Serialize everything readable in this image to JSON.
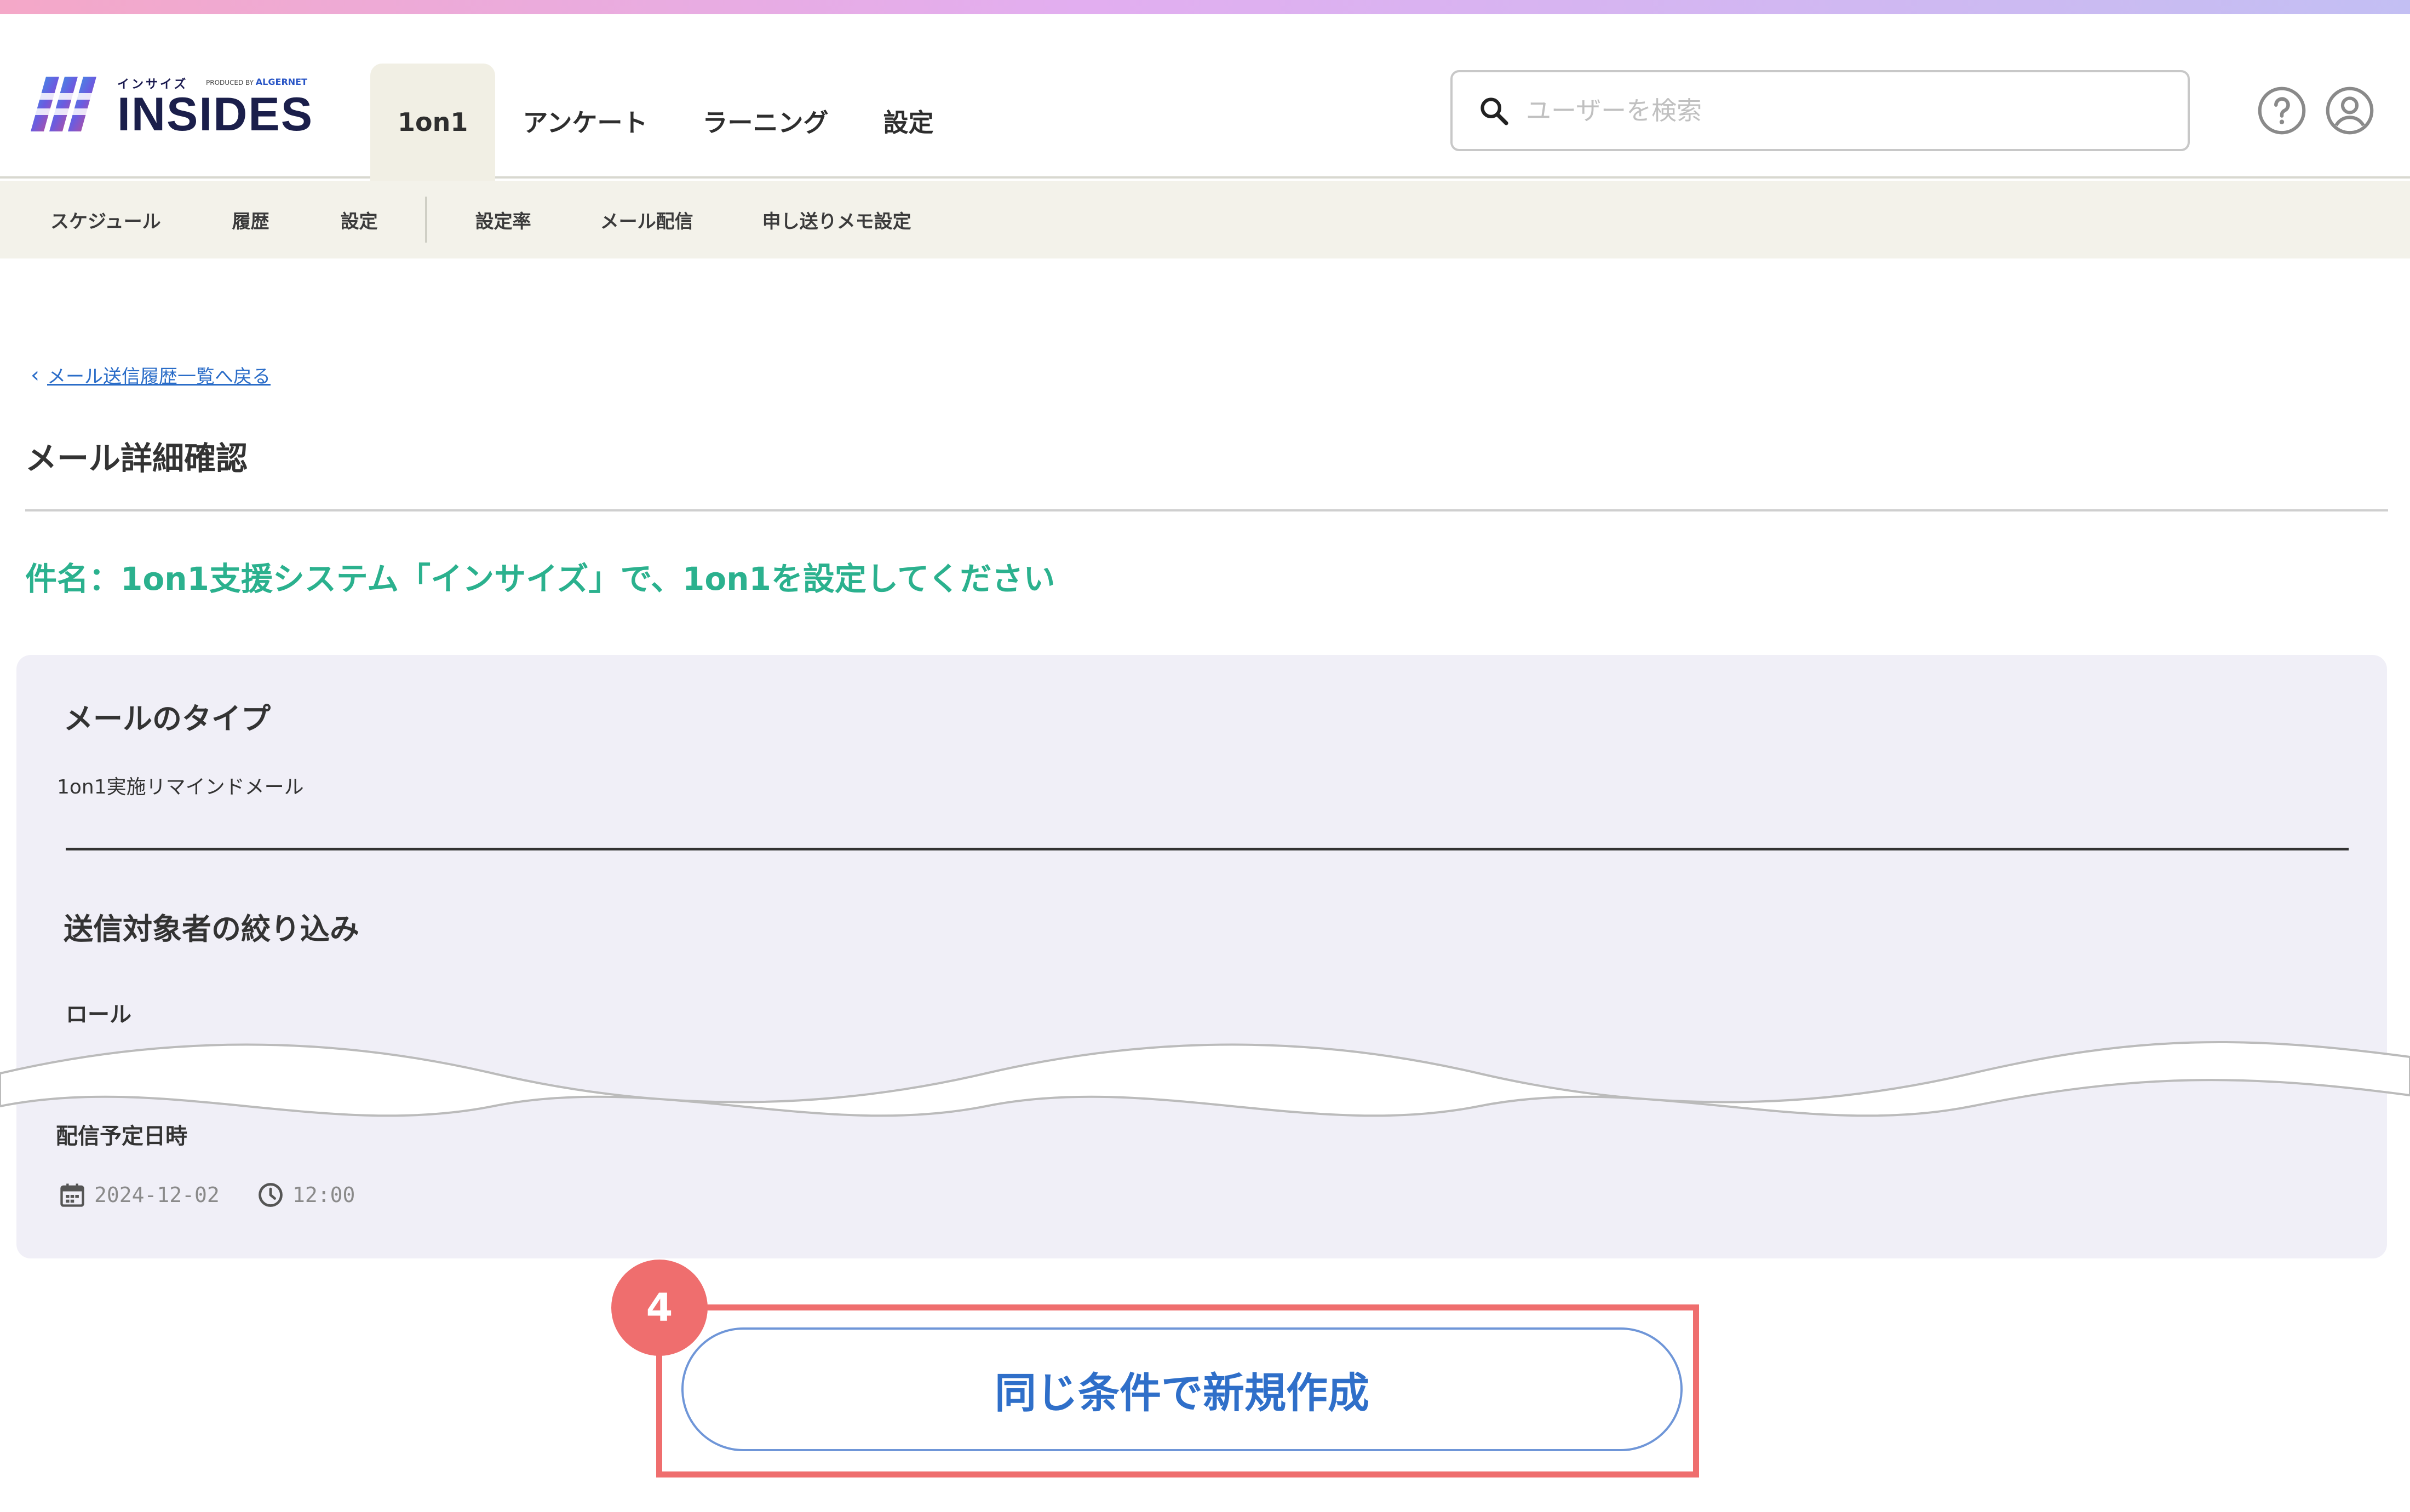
{
  "header": {
    "logo_small": "インサイズ",
    "logo_tiny": "PRODUCED BY",
    "logo_tiny_brand": "ALGERNET",
    "logo_text": "INSIDES",
    "nav": [
      {
        "label": "1on1",
        "active": true
      },
      {
        "label": "アンケート",
        "active": false
      },
      {
        "label": "ラーニング",
        "active": false
      },
      {
        "label": "設定",
        "active": false
      }
    ],
    "search_placeholder": "ユーザーを検索",
    "icons": [
      "help-icon",
      "user-account-icon"
    ]
  },
  "subnav": {
    "items": [
      "スケジュール",
      "履歴",
      "設定",
      "設定率",
      "メール配信",
      "申し送りメモ設定"
    ]
  },
  "content": {
    "back_link": "メール送信履歴一覧へ戻る",
    "page_title": "メール詳細確認",
    "subject": "件名：1on1支援システム「インサイズ」で、1on1を設定してください",
    "mail_type_heading": "メールのタイプ",
    "mail_type_value": "1on1実施リマインドメール",
    "filter_heading": "送信対象者の絞り込み",
    "role_label": "ロール",
    "schedule_label": "配信予定日時",
    "date": "2024-12-02",
    "time": "12:00"
  },
  "cta": {
    "step": "4",
    "label": "同じ条件で新規作成"
  },
  "colors": {
    "accent_green": "#2bb18e",
    "link_blue": "#2b6dc8",
    "highlight_red": "#ef6e6e",
    "panel_bg": "#f0eff7",
    "subnav_bg": "#f3f2ea"
  }
}
